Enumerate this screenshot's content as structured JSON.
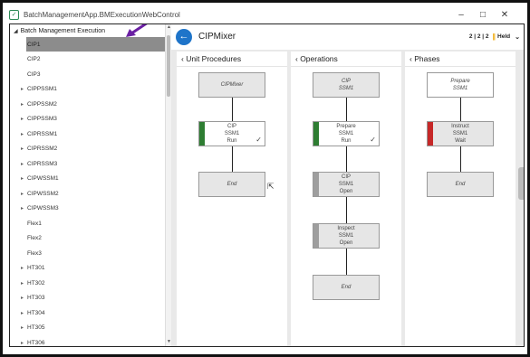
{
  "window": {
    "title": "BatchManagementApp.BMExecutionWebControl",
    "minimize": "–",
    "maximize": "□",
    "close": "✕"
  },
  "tree": {
    "root_label": "Batch Management Execution",
    "items": [
      {
        "label": "CIP1",
        "expandable": false,
        "selected": true
      },
      {
        "label": "CIP2",
        "expandable": false
      },
      {
        "label": "CIP3",
        "expandable": false
      },
      {
        "label": "CIPPSSM1",
        "expandable": true
      },
      {
        "label": "CIPPSSM2",
        "expandable": true
      },
      {
        "label": "CIPPSSM3",
        "expandable": true
      },
      {
        "label": "CIPRSSM1",
        "expandable": true
      },
      {
        "label": "CIPRSSM2",
        "expandable": true
      },
      {
        "label": "CIPRSSM3",
        "expandable": true
      },
      {
        "label": "CIPWSSM1",
        "expandable": true
      },
      {
        "label": "CIPWSSM2",
        "expandable": true
      },
      {
        "label": "CIPWSSM3",
        "expandable": true
      },
      {
        "label": "Flex1",
        "expandable": false
      },
      {
        "label": "Flex2",
        "expandable": false
      },
      {
        "label": "Flex3",
        "expandable": false
      },
      {
        "label": "HT301",
        "expandable": true
      },
      {
        "label": "HT302",
        "expandable": true
      },
      {
        "label": "HT303",
        "expandable": true
      },
      {
        "label": "HT304",
        "expandable": true
      },
      {
        "label": "HT305",
        "expandable": true
      },
      {
        "label": "HT306",
        "expandable": true
      }
    ]
  },
  "header": {
    "back_icon": "←",
    "title": "CIPMixer",
    "counts": "2 | 2 | 2",
    "state": "Held",
    "pause_icon": "||",
    "chevron": "⌄"
  },
  "columns": {
    "unit_procedures": {
      "heading": "‹ Unit Procedures",
      "nodes": [
        {
          "lines": [
            "CIPMixer"
          ],
          "italic": true
        },
        {
          "lines": [
            "CIP",
            "SSM1",
            "Run"
          ],
          "bar": "#2e7d32",
          "check": true,
          "white": true
        },
        {
          "lines": [
            "End"
          ],
          "italic": true
        }
      ]
    },
    "operations": {
      "heading": "‹ Operations",
      "nodes": [
        {
          "lines": [
            "CIP",
            "SSM1"
          ],
          "italic": true
        },
        {
          "lines": [
            "Prepare",
            "SSM1",
            "Run"
          ],
          "bar": "#2e7d32",
          "check": true,
          "white": true
        },
        {
          "lines": [
            "CIP",
            "SSM1",
            "Open"
          ],
          "bar": "#9e9e9e"
        },
        {
          "lines": [
            "Inspect",
            "SSM1",
            "Open"
          ],
          "bar": "#9e9e9e"
        },
        {
          "lines": [
            "End"
          ],
          "italic": true
        }
      ]
    },
    "phases": {
      "heading": "‹ Phases",
      "nodes": [
        {
          "lines": [
            "Prepare",
            "SSM1"
          ],
          "italic": true,
          "white": true
        },
        {
          "lines": [
            "Instruct",
            "SSM1",
            "Wait"
          ],
          "bar": "#c62828"
        },
        {
          "lines": [
            "End"
          ],
          "italic": true
        }
      ]
    }
  },
  "colors": {
    "accent": "#1e74c9",
    "run_green": "#2e7d32",
    "wait_red": "#c62828",
    "held_yellow": "#f2b01e"
  }
}
